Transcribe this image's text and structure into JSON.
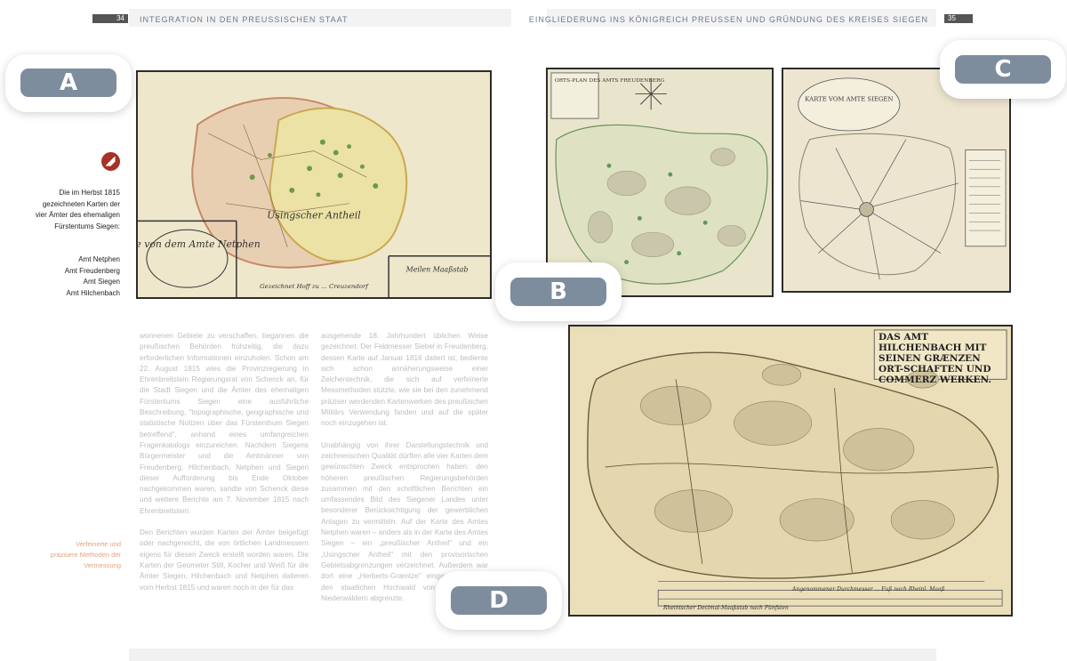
{
  "header": {
    "left_page_number": "34",
    "left_title": "INTEGRATION IN DEN PREUSSISCHEN STAAT",
    "right_title": "EINGLIEDERUNG INS KÖNIGREICH PREUSSEN UND GRÜNDUNG DES KREISES SIEGEN",
    "right_page_number": "35"
  },
  "badges": {
    "a": "A",
    "b": "B",
    "c": "C",
    "d": "D"
  },
  "sidebar": {
    "icon": "map-pin-icon",
    "caption": "Die im Herbst 1815 gezeichneten Karten der vier Ämter des ehemaligen Fürstentums Siegen:",
    "list": [
      "Amt Netphen",
      "Amt Freudenberg",
      "Amt Siegen",
      "Amt Hilchenbach"
    ],
    "margin_note": "Verfeinerte und präzisere Methoden der Vermessung"
  },
  "maps": {
    "a": {
      "cartouche": "Karte von dem Amte Netphen",
      "label_center": "Usingscher Antheil",
      "scale_box": "Meilen Maaßstab",
      "footer": "Gezeichnet Hoff zu ... Creuzendorf"
    },
    "b": {
      "title_block": "ORTS-PLAN DES AMTS FREUDENBERG"
    },
    "c": {
      "title_block": "KARTE VOM AMTE SIEGEN"
    },
    "d": {
      "title": "DAS AMT HILCHENBACH MIT SEINEN GRÆNZEN ORT-SCHAFTEN UND COMMERZ WERKEN.",
      "subtitle_note": "Angenommener Durchmesser ... Fuß nach Rheinl. Maaß",
      "bottom_note": "Rheinischer Decimal-Maaßstab nach Fünfsten"
    }
  },
  "body_text": {
    "col1_p1": "wonnenen Gebiete zu verschaffen, begannen die preußischen Behörden frühzeitig, die dazu erforderlichen Informationen einzuholen. Schon am 22. August 1815 wies die Provinzregierung in Ehrenbreitstein Regierungsrat von Schenck an, für die Stadt Siegen und die Ämter des ehemaligen Fürstentums Siegen eine ausführliche Beschreibung, \"topographische, geographische und statistische Notizen über das Fürstenthum Siegen betreffend\", anhand eines umfangreichen Fragenkatalogs einzureichen. Nachdem Siegens Bürgermeister und die Amtmänner von Freudenberg, Hilchenbach, Netphen und Siegen dieser Aufforderung bis Ende Oktober nachgekommen waren, sandte von Schenck diese und weitere Berichte am 7. November 1815 nach Ehrenbreitstein.",
    "col1_p2": "Den Berichten wurden Karten der Ämter beigefügt oder nachgereicht, die von örtlichen Landmessern eigens für diesen Zweck erstellt worden waren. Die Karten der Geometer Still, Kocher und Weiß für die Ämter Siegen, Hilchenbach und Netphen datieren vom Herbst 1815 und waren noch in der für das",
    "col2_p1": "ausgehende 18. Jahrhundert üblichen Weise gezeichnet. Der Feldmesser Siebel in Freudenberg, dessen Karte auf Januar 1816 datiert ist, bediente sich schon annäherungsweise einer Zeichentechnik, die sich auf verfeinerte Messmethoden stützte, wie sie bei den zunehmend präziser werdenden Kartenwerken des preußischen Militärs Verwendung fanden und auf die später noch einzugehen ist.",
    "col2_p2": "Unabhängig von ihrer Darstellungstechnik und zeichnerischen Qualität dürften alle vier Karten dem gewünschten Zweck entsprochen haben: den höheren preußischen Regierungsbehörden zusammen mit den schriftlichen Berichten ein umfassendes Bild des Siegener Landes unter besonderer Berücksichtigung der gewerblichen Anlagen zu vermitteln. Auf der Karte des Amtes Netphen waren – anders als in der Karte des Amtes Siegen – ein „preußischer Antheil\" und ein „Usingscher Antheil\" mit den provisorischen Gebietsabgrenzungen verzeichnet. Außerdem war dort eine „Herberts-Græntze\" eingezeichnet, die den staatlichen Hochwald von den privaten Niederwäldern abgrenzte."
  }
}
